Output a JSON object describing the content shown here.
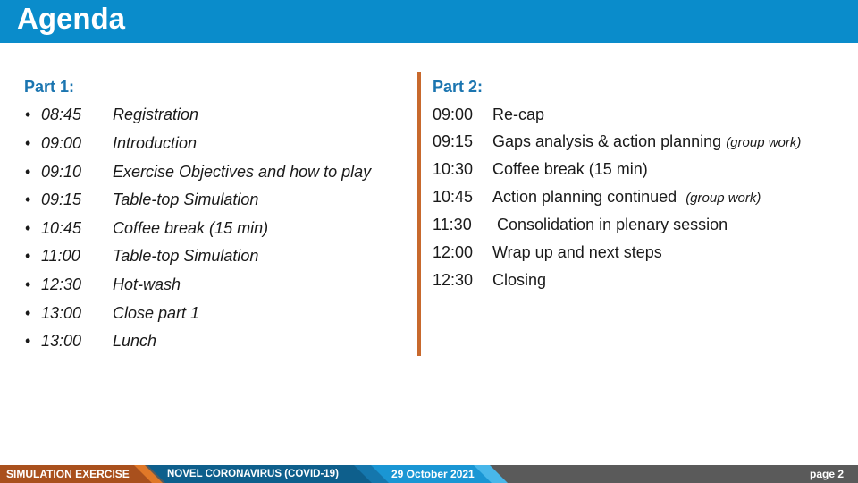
{
  "header": {
    "title": "Agenda",
    "bar_color": "#0a8ccb"
  },
  "part1": {
    "heading": "Part 1:",
    "bullet": "•",
    "items": [
      {
        "time": "08:45",
        "label": "Registration"
      },
      {
        "time": "09:00",
        "label": "Introduction"
      },
      {
        "time": "09:10",
        "label": "Exercise Objectives and how to play"
      },
      {
        "time": "09:15",
        "label": "Table-top Simulation"
      },
      {
        "time": "10:45",
        "label": "Coffee break (15 min)"
      },
      {
        "time": "11:00",
        "label": "Table-top Simulation"
      },
      {
        "time": "12:30",
        "label": "Hot-wash"
      },
      {
        "time": "13:00",
        "label": "Close part 1"
      },
      {
        "time": "13:00",
        "label": "Lunch"
      }
    ]
  },
  "part2": {
    "heading": "Part 2:",
    "items": [
      {
        "time": "09:00",
        "label": "Re-cap",
        "note": ""
      },
      {
        "time": "09:15",
        "label": "Gaps analysis & action planning",
        "note": "(group work)"
      },
      {
        "time": "10:30",
        "label": "Coffee break (15 min)",
        "note": ""
      },
      {
        "time": "10:45",
        "label": "Action planning continued ",
        "note": "(group work)"
      },
      {
        "time": "11:30",
        "label": " Consolidation in plenary session",
        "note": ""
      },
      {
        "time": "12:00",
        "label": "Wrap up and next steps",
        "note": ""
      },
      {
        "time": "12:30",
        "label": "Closing",
        "note": ""
      }
    ]
  },
  "divider_color": "#c8692d",
  "footer": {
    "exercise": "SIMULATION EXERCISE",
    "disease": "NOVEL CORONAVIRUS (COVID-19)",
    "date": "29 October 2021",
    "page": "page 2"
  }
}
